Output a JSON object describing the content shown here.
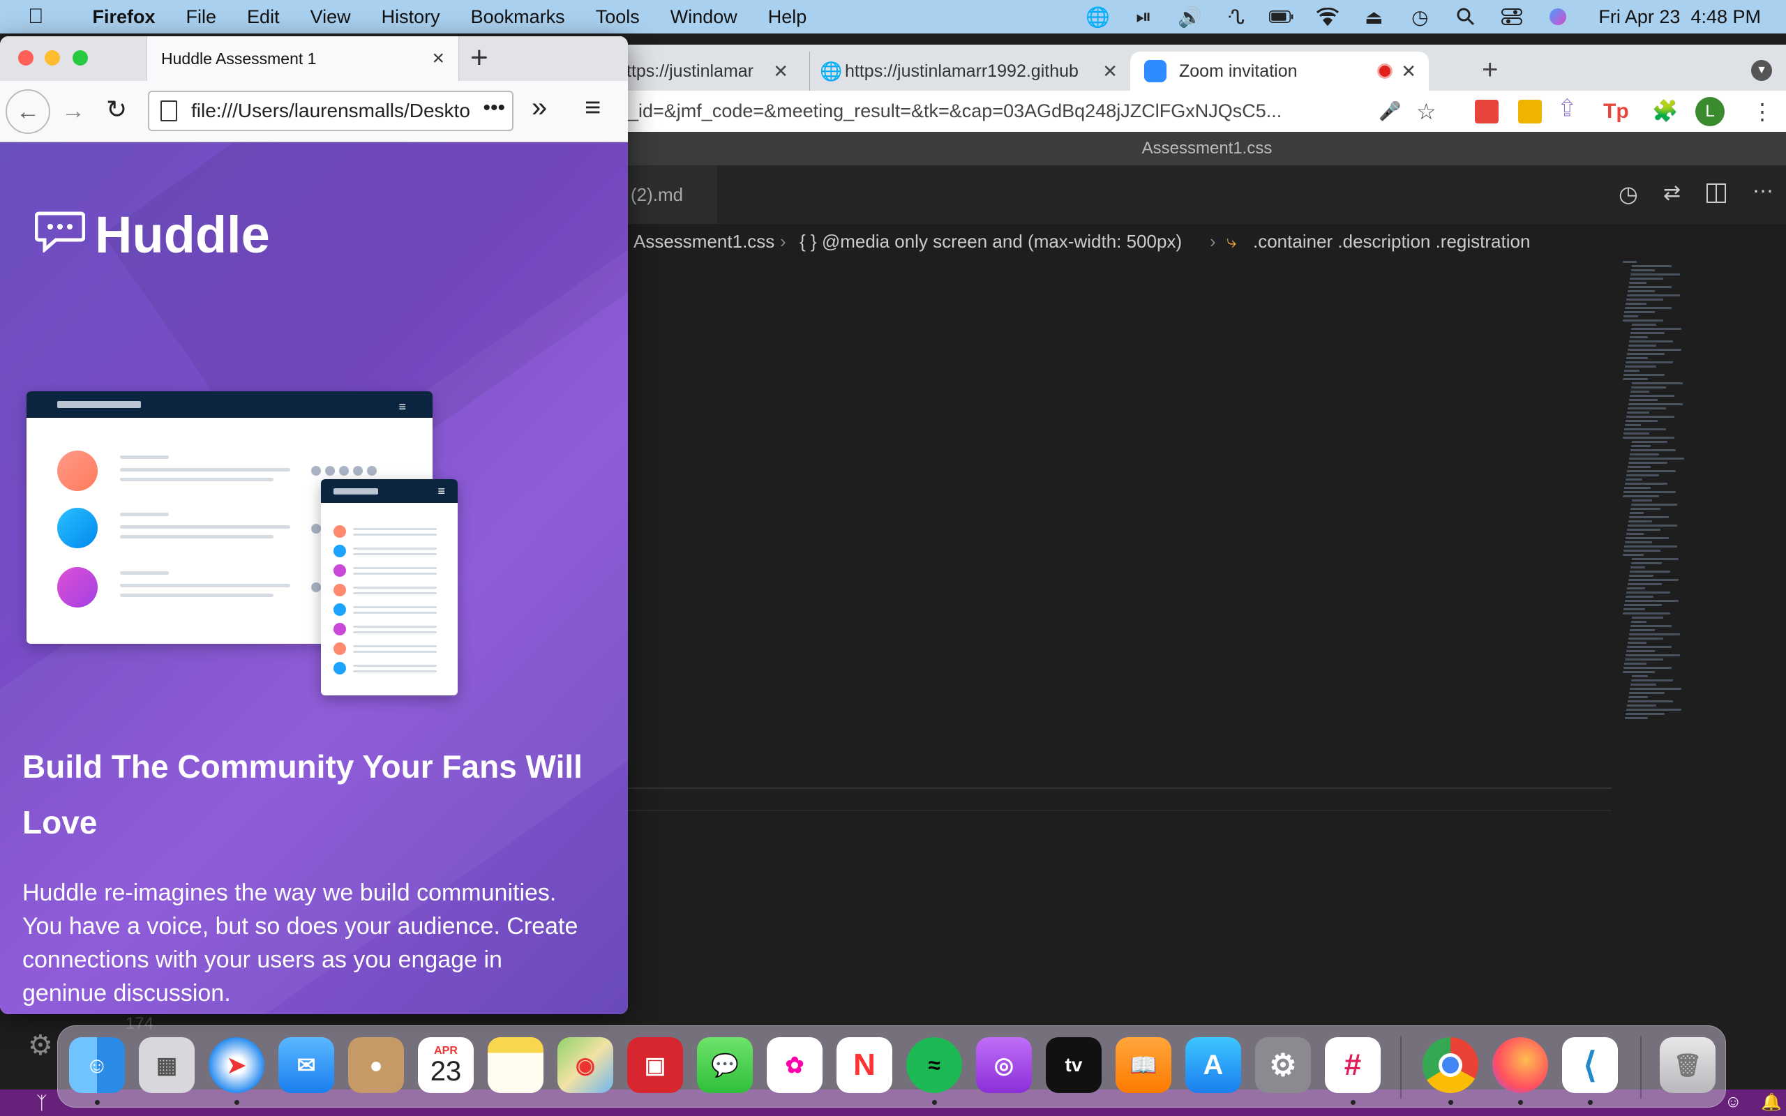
{
  "menubar": {
    "app_name": "Firefox",
    "items": [
      "File",
      "Edit",
      "View",
      "History",
      "Bookmarks",
      "Tools",
      "Window",
      "Help"
    ],
    "datetime": "Fri Apr 23  4:48 PM"
  },
  "chrome": {
    "tabs": [
      {
        "title": "ttps://justinlamar"
      },
      {
        "title": "https://justinlamarr1992.github"
      },
      {
        "title": "Zoom invitation"
      }
    ],
    "address": "_id=&jmf_code=&meeting_result=&tk=&cap=03AGdBq248jJZClFGxNJQsC5...",
    "profile_initial": "L"
  },
  "vscode": {
    "title": "Assessment1.css",
    "tab_label": "(2).md",
    "breadcrumb": {
      "file": "Assessment1.css",
      "media": "{ } @media only screen and (max-width: 500px)",
      "selector": ".container .description .registration"
    },
    "line_number": "174"
  },
  "firefox": {
    "tab_title": "Huddle Assessment 1",
    "url": "file:///Users/laurensmalls/Deskto",
    "page": {
      "logo_text": "Huddle",
      "headline": "Build The Community Your Fans Will Love",
      "description": "Huddle re-imagines the way we build communities. You have a voice, but so does your audience. Create connections with your users as you engage in geninue discussion."
    }
  },
  "dock": {
    "calendar_month": "APR",
    "calendar_day": "23",
    "apps": [
      "finder-icon",
      "launchpad-icon",
      "safari-icon",
      "mail-icon",
      "contacts-icon",
      "calendar-icon",
      "notes-icon",
      "maps-icon",
      "photo-booth-icon",
      "messages-icon",
      "photos-icon",
      "news-icon",
      "spotify-icon",
      "podcasts-icon",
      "apple-tv-icon",
      "books-icon",
      "app-store-icon",
      "system-preferences-icon",
      "slack-icon",
      "chrome-icon",
      "firefox-icon",
      "vscode-icon",
      "trash-icon"
    ]
  },
  "colors": {
    "menubar": "#a9d0ef",
    "huddle_purple": "#7a4cc9",
    "vscode_bg": "#1e1e1e",
    "vscode_status": "#68217a"
  }
}
